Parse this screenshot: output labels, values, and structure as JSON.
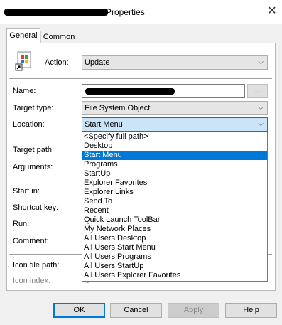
{
  "window": {
    "title": "Properties",
    "close_icon": "close-icon"
  },
  "tabs": [
    {
      "label": "General",
      "active": true
    },
    {
      "label": "Common",
      "active": false
    }
  ],
  "action": {
    "label": "Action:",
    "value": "Update"
  },
  "fields": {
    "name_label": "Name:",
    "target_type_label": "Target type:",
    "target_type_value": "File System Object",
    "location_label": "Location:",
    "location_value": "Start Menu",
    "target_path_label": "Target path:",
    "arguments_label": "Arguments:",
    "start_in_label": "Start in:",
    "shortcut_key_label": "Shortcut key:",
    "run_label": "Run:",
    "comment_label": "Comment:",
    "icon_file_path_label": "Icon file path:",
    "icon_index_label": "Icon index:",
    "icon_index_value": "0",
    "browse_label": "..."
  },
  "location_options": [
    "<Specify full path>",
    "Desktop",
    "Start Menu",
    "Programs",
    "StartUp",
    "Explorer Favorites",
    "Explorer Links",
    "Send To",
    "Recent",
    "Quick Launch ToolBar",
    "My Network Places",
    "All Users Desktop",
    "All Users Start Menu",
    "All Users Programs",
    "All Users StartUp",
    "All Users Explorer Favorites"
  ],
  "location_selected_index": 2,
  "buttons": {
    "ok": "OK",
    "cancel": "Cancel",
    "apply": "Apply",
    "help": "Help"
  },
  "colors": {
    "selection": "#0078d7",
    "focus_fill": "#cce4f7"
  }
}
